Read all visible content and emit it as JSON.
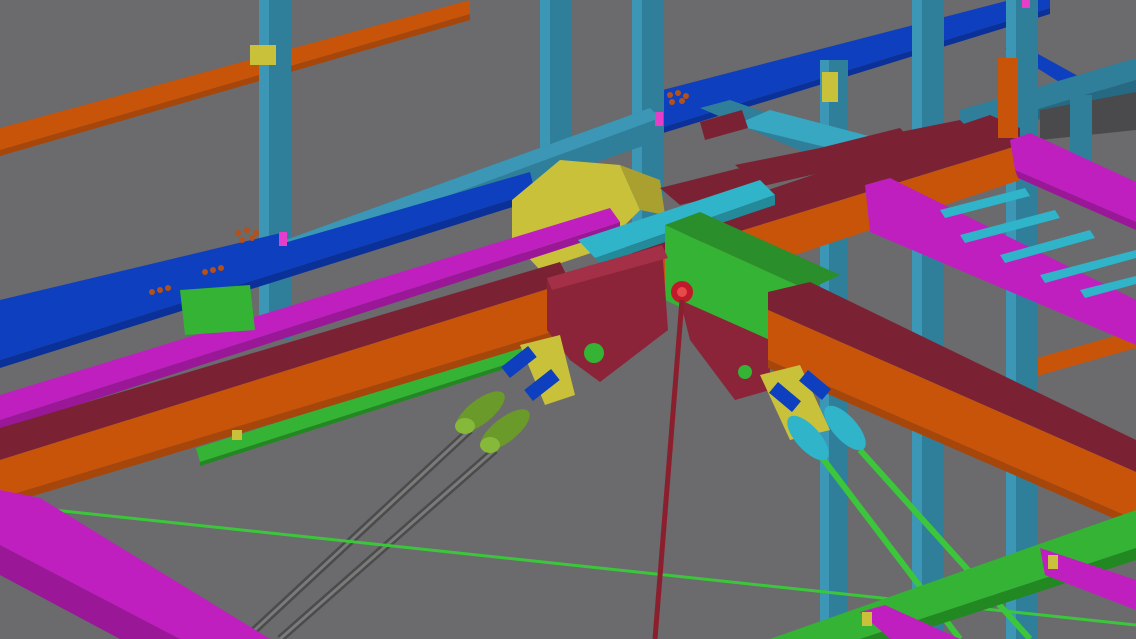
{
  "scene": {
    "kind": "3D steel structure model viewport",
    "background_color": "#6b6a6c",
    "member_colors": {
      "column": "#2f7f9a",
      "column_light": "#3b97b5",
      "beam_blue": "#0d3fbf",
      "beam_orange": "#c8540a",
      "beam_orange_dark": "#a7460a",
      "beam_maroon": "#7a2234",
      "beam_maroon_dark": "#5e1a29",
      "beam_magenta": "#c01fc0",
      "beam_magenta_dark": "#9a1798",
      "beam_green": "#34b334",
      "plate_yellow": "#c9c13a",
      "cable_grey": "#5a5a5a",
      "cable_green": "#3cc63c",
      "socket_olive": "#6a9a2a",
      "socket_cyan": "#2fb4c9",
      "rod_red": "#8b1f2e"
    }
  }
}
